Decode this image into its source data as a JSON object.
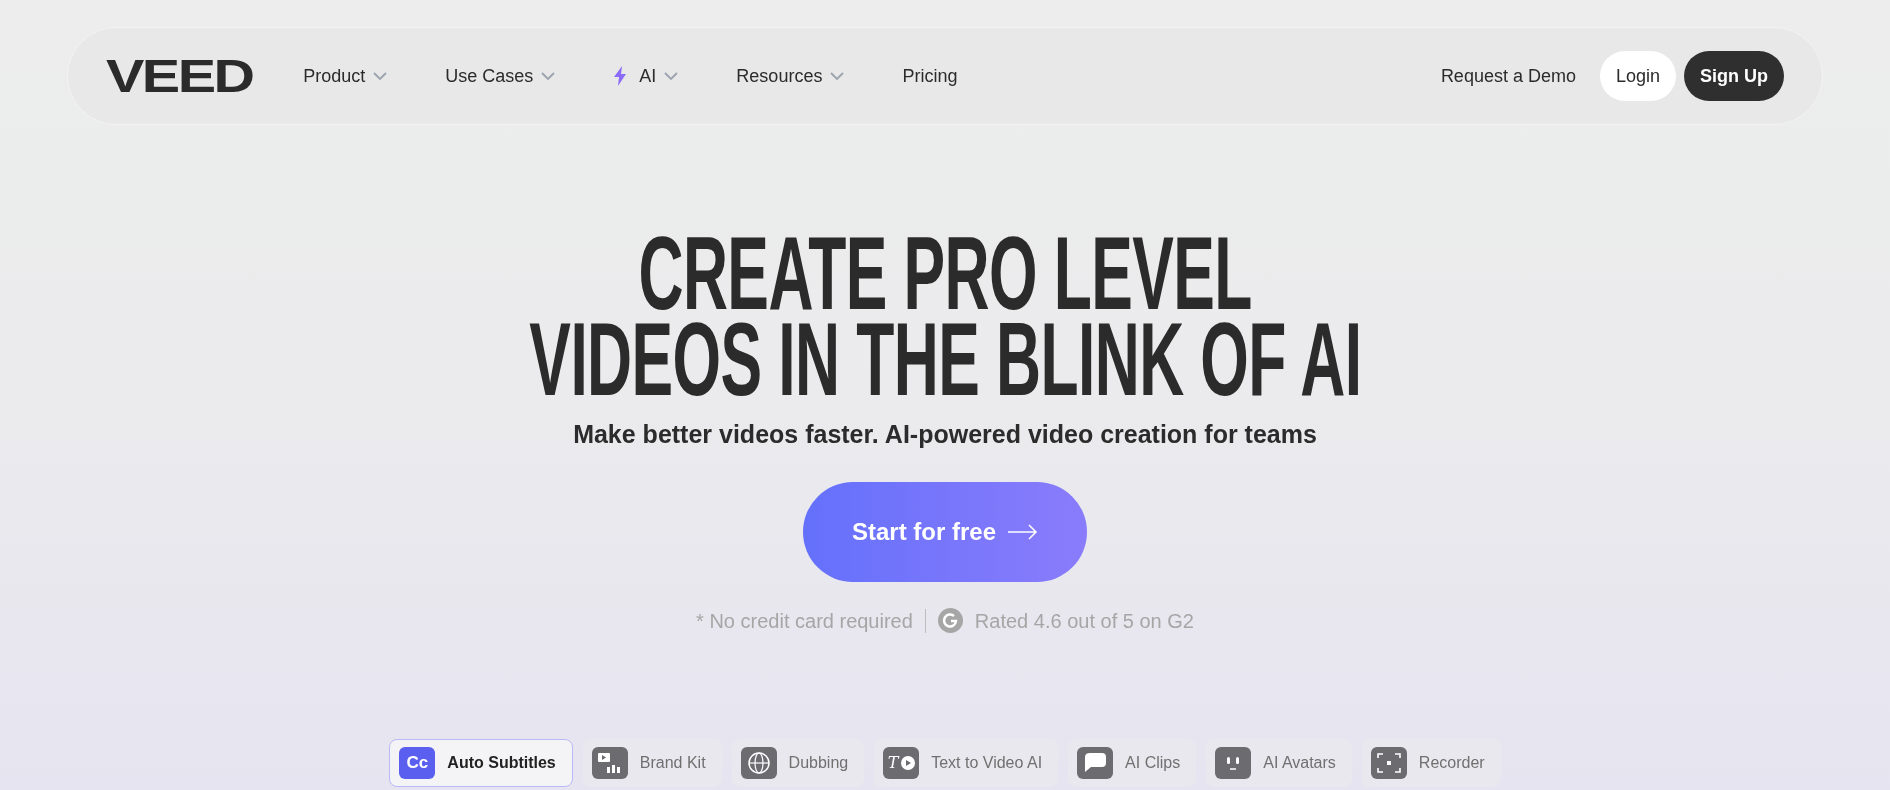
{
  "nav": {
    "logo": "VEED",
    "items": [
      {
        "label": "Product",
        "dropdown": true,
        "ai": false
      },
      {
        "label": "Use Cases",
        "dropdown": true,
        "ai": false
      },
      {
        "label": "AI",
        "dropdown": true,
        "ai": true
      },
      {
        "label": "Resources",
        "dropdown": true,
        "ai": false
      },
      {
        "label": "Pricing",
        "dropdown": false,
        "ai": false
      }
    ],
    "demo": "Request a Demo",
    "login": "Login",
    "signup": "Sign Up"
  },
  "hero": {
    "title_lines": [
      "CREATE PRO LEVEL",
      "VIDEOS IN THE BLINK OF AI"
    ],
    "subtitle": "Make better videos faster. AI-powered video creation for teams",
    "cta": "Start for free",
    "note": "* No credit card required",
    "rating": "Rated 4.6 out of 5 on G2"
  },
  "features": [
    {
      "label": "Auto Subtitles",
      "icon_text": "Cc",
      "kind": "cc",
      "selected": true
    },
    {
      "label": "Brand Kit",
      "kind": "brand",
      "selected": false
    },
    {
      "label": "Dubbing",
      "kind": "globe",
      "selected": false
    },
    {
      "label": "Text to Video AI",
      "icon_text": "T",
      "kind": "textvideo",
      "selected": false
    },
    {
      "label": "AI Clips",
      "kind": "clips",
      "selected": false
    },
    {
      "label": "AI Avatars",
      "kind": "avatar",
      "selected": false
    },
    {
      "label": "Recorder",
      "kind": "recorder",
      "selected": false
    }
  ]
}
